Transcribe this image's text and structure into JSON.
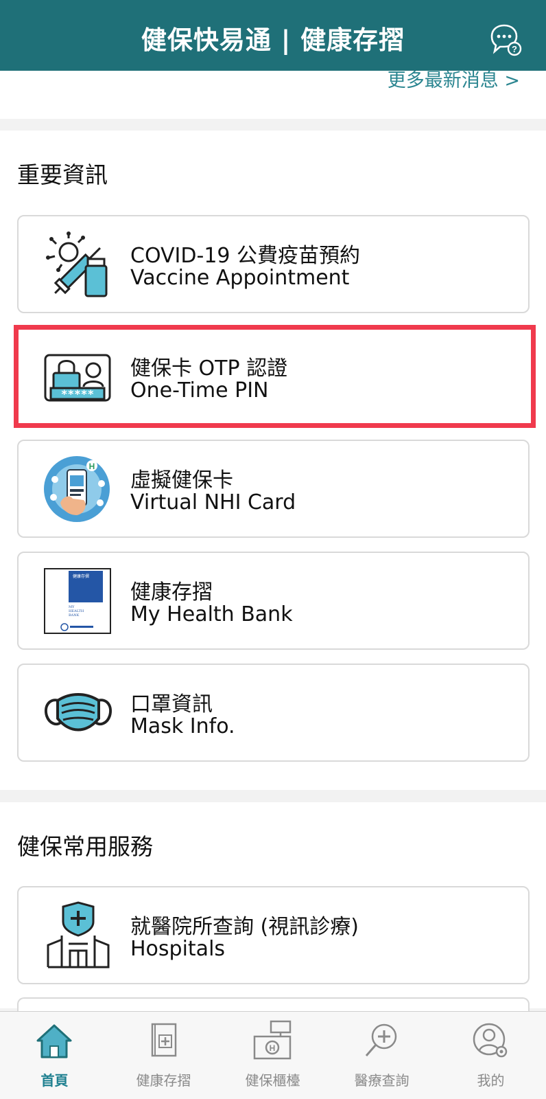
{
  "header": {
    "title": "健保快易通 | 健康存摺",
    "chat_icon": "chat-help-icon"
  },
  "news": {
    "more_link": "更多最新消息 >"
  },
  "important": {
    "title": "重要資訊",
    "items": [
      {
        "zh": "COVID-19 公費疫苗預約",
        "en": "Vaccine Appointment",
        "icon": "vaccine-icon"
      },
      {
        "zh": "健保卡 OTP 認證",
        "en": "One-Time PIN",
        "icon": "otp-lock-icon"
      },
      {
        "zh": "虛擬健保卡",
        "en": "Virtual NHI Card",
        "icon": "virtual-card-icon"
      },
      {
        "zh": "健康存摺",
        "en": "My Health Bank",
        "icon": "health-bank-book-icon"
      },
      {
        "zh": "口罩資訊",
        "en": "Mask Info.",
        "icon": "mask-icon"
      }
    ]
  },
  "common": {
    "title": "健保常用服務",
    "items": [
      {
        "zh": "就醫院所查詢 (視訊診療)",
        "en": "Hospitals",
        "icon": "hospital-icon"
      }
    ]
  },
  "tabs": [
    {
      "label": "首頁",
      "icon": "home-icon",
      "active": true
    },
    {
      "label": "健康存摺",
      "icon": "health-record-icon",
      "active": false
    },
    {
      "label": "健保櫃檯",
      "icon": "counter-icon",
      "active": false
    },
    {
      "label": "醫療查詢",
      "icon": "medical-search-icon",
      "active": false
    },
    {
      "label": "我的",
      "icon": "profile-icon",
      "active": false
    }
  ],
  "colors": {
    "header": "#1f7078",
    "accent": "#2a8590",
    "highlight": "#f03a4d",
    "icon_blue": "#5bc0d6"
  },
  "book_icon_text": {
    "title": "健康存摺",
    "line1": "MY",
    "line2": "HEALTH",
    "line3": "BANK"
  }
}
